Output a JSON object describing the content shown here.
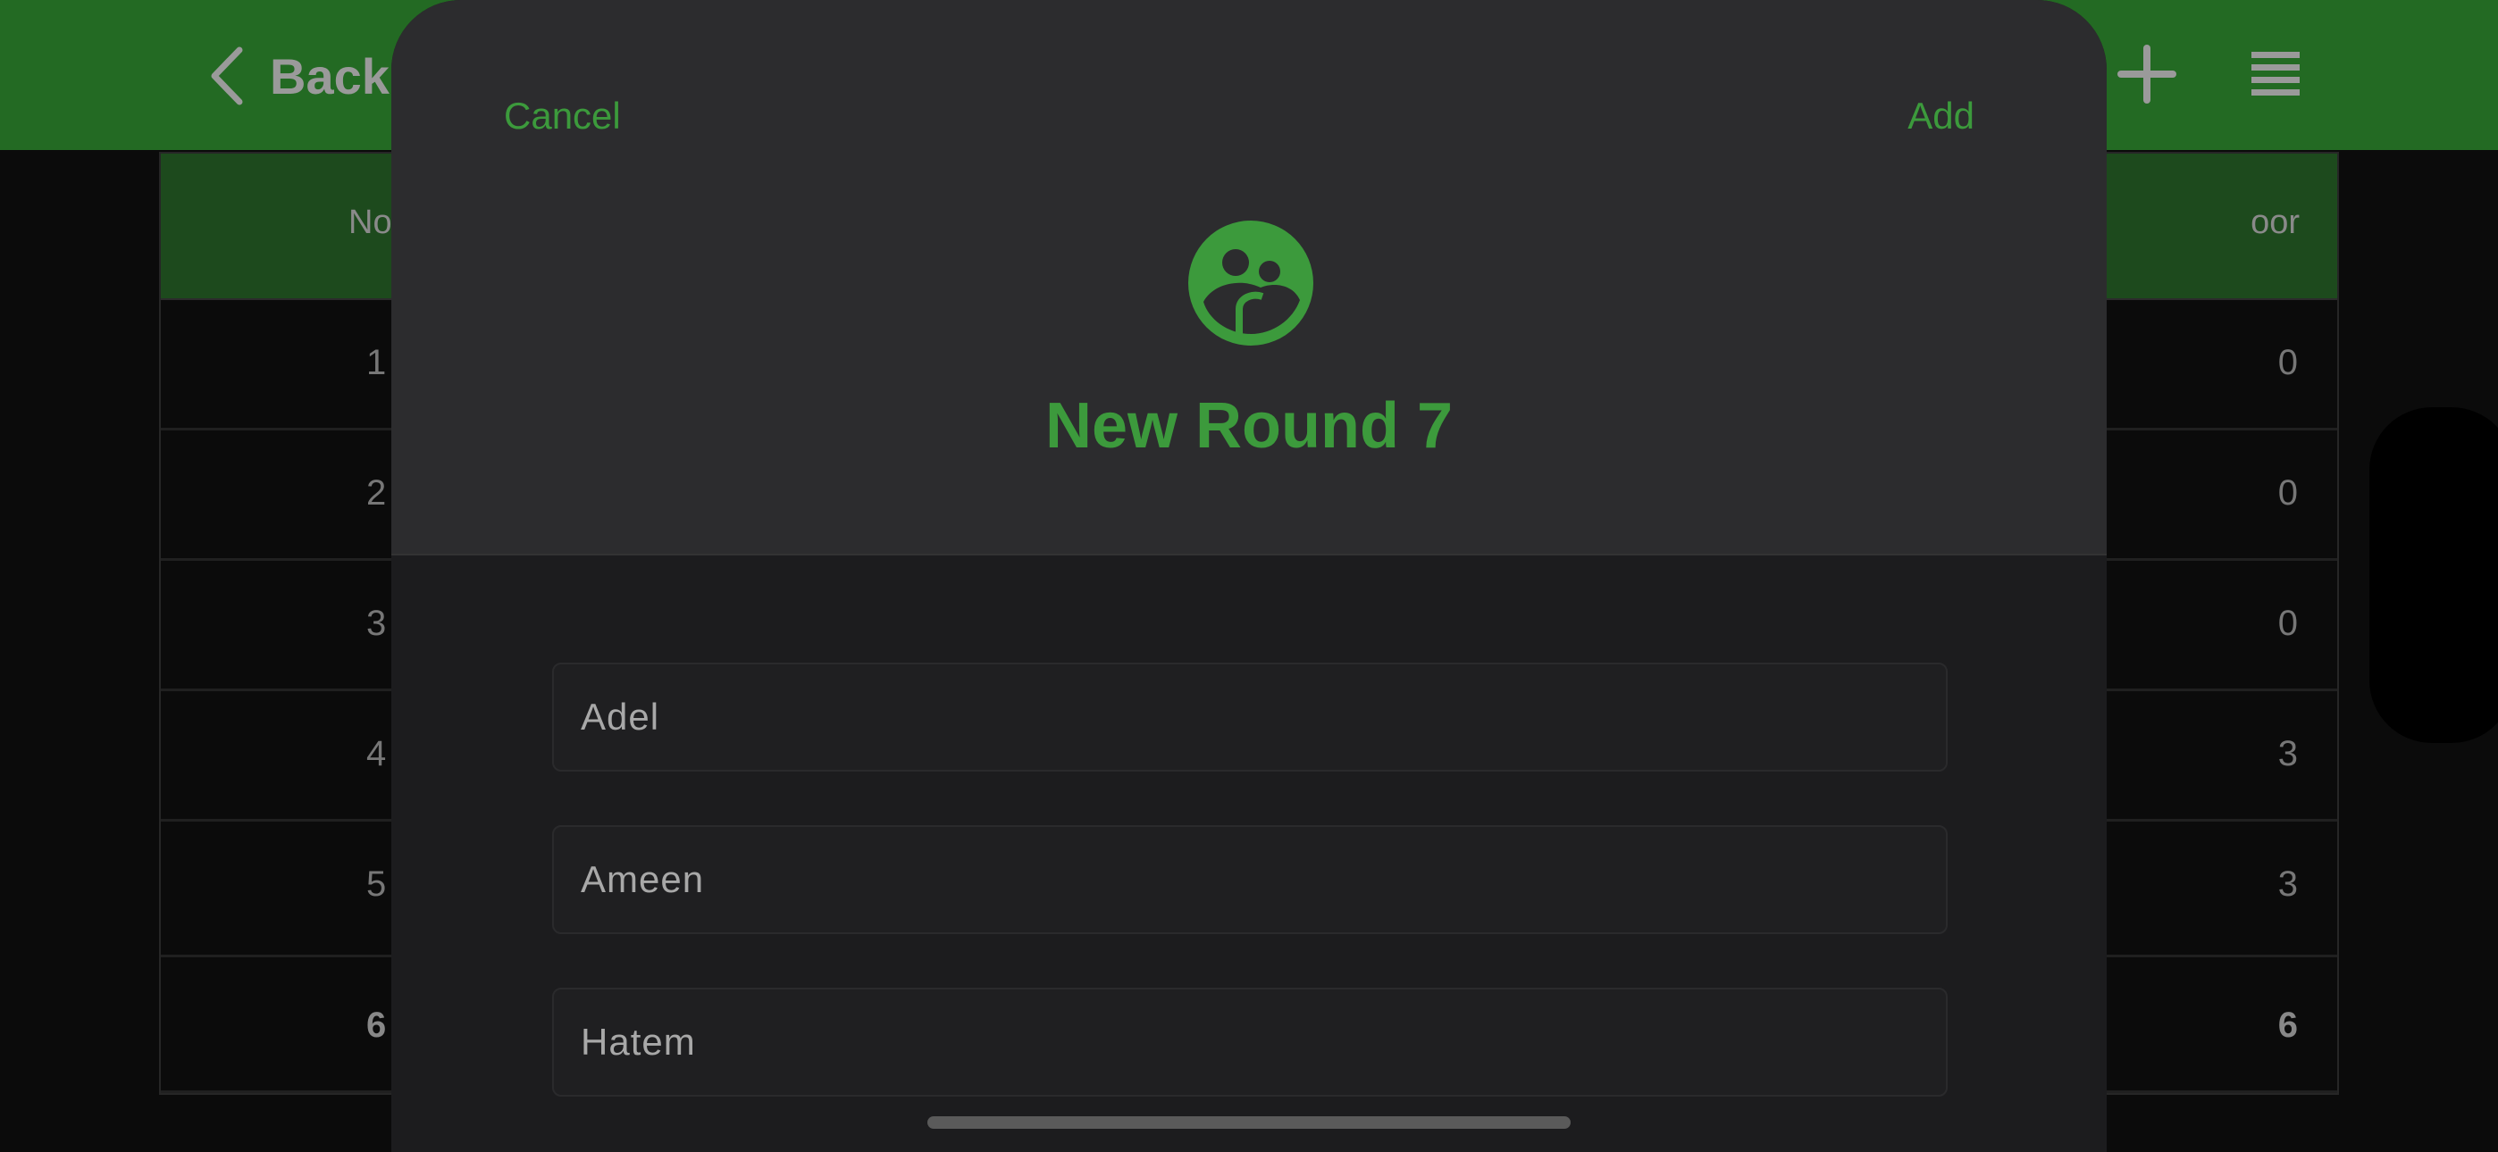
{
  "nav": {
    "back_label": "Back",
    "accent": "#236a23",
    "icons": [
      "chevron-left-icon",
      "plus-icon",
      "list-icon"
    ]
  },
  "table": {
    "header_left": "No",
    "header_right": "oor",
    "rows": [
      {
        "left": "1",
        "right": "0"
      },
      {
        "left": "2",
        "right": "0"
      },
      {
        "left": "3",
        "right": "0"
      },
      {
        "left": "4",
        "right": "3"
      },
      {
        "left": "5",
        "right": "3"
      }
    ],
    "total": {
      "left": "6",
      "right": "6"
    }
  },
  "modal": {
    "cancel_label": "Cancel",
    "add_label": "Add",
    "icon": "group-icon",
    "title": "New Round 7",
    "accent": "#3c9a3c",
    "players": [
      {
        "value": "Adel"
      },
      {
        "value": "Ameen"
      },
      {
        "value": "Hatem"
      }
    ]
  }
}
